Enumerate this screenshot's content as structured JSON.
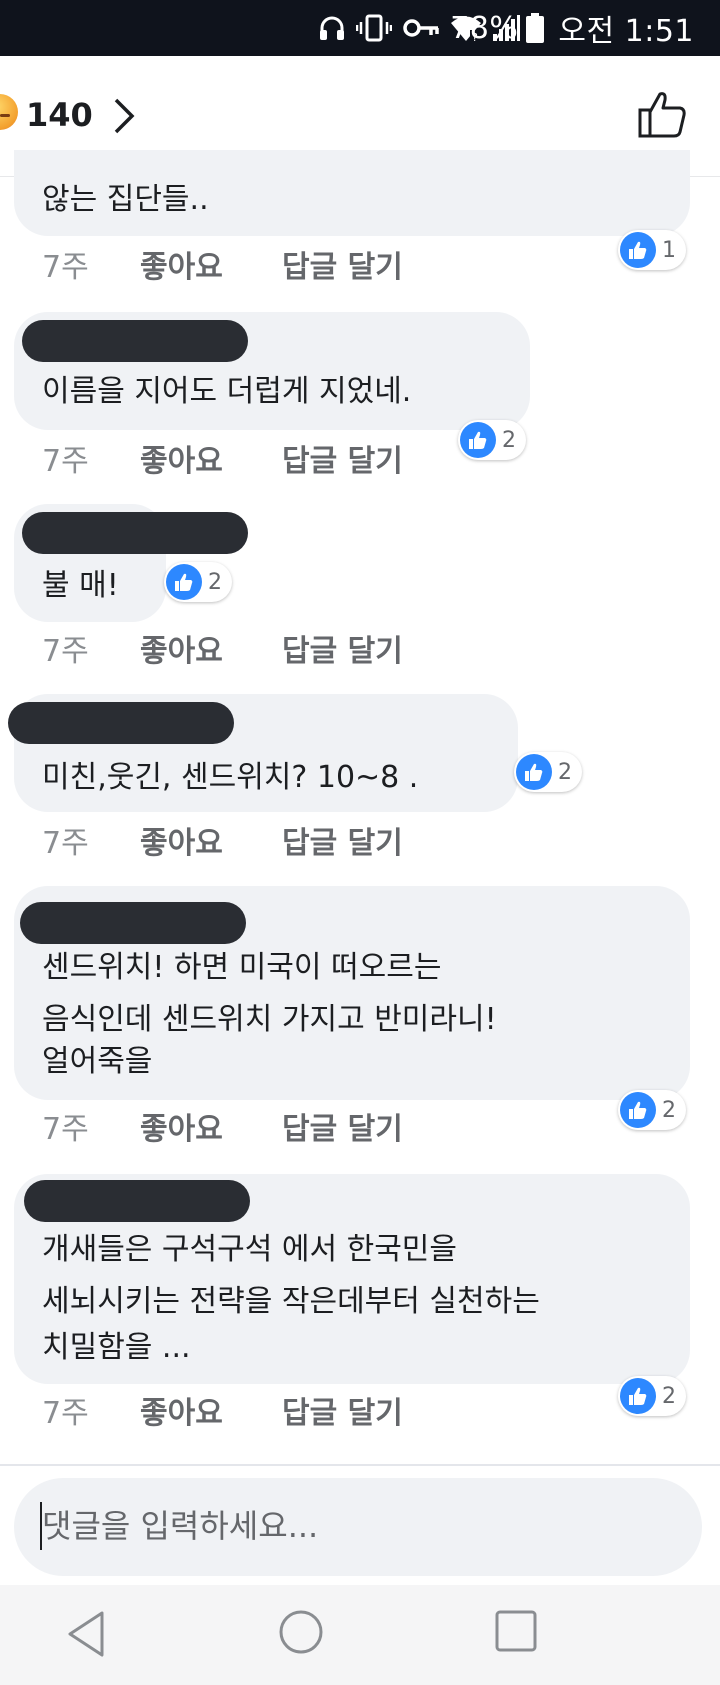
{
  "status_bar": {
    "battery": "78%",
    "time": "오전 1:51"
  },
  "header": {
    "reaction_count": "140"
  },
  "comments": [
    {
      "text_lines": [
        "않는 집단들.."
      ],
      "time": "7주",
      "like_label": "좋아요",
      "reply_label": "답글 달기",
      "reaction_count": "1"
    },
    {
      "text_lines": [
        "이름을 지어도 더럽게 지었네."
      ],
      "time": "7주",
      "like_label": "좋아요",
      "reply_label": "답글 달기",
      "reaction_count": "2"
    },
    {
      "text_lines": [
        "불 매!"
      ],
      "time": "7주",
      "like_label": "좋아요",
      "reply_label": "답글 달기",
      "reaction_count": "2"
    },
    {
      "text_lines": [
        "미친,웃긴, 센드위치? 10~8 ."
      ],
      "time": "7주",
      "like_label": "좋아요",
      "reply_label": "답글 달기",
      "reaction_count": "2"
    },
    {
      "text_lines": [
        "센드위치! 하면 미국이 떠오르는",
        "음식인데  센드위치 가지고 반미라니!",
        "얼어죽을"
      ],
      "time": "7주",
      "like_label": "좋아요",
      "reply_label": "답글 달기",
      "reaction_count": "2"
    },
    {
      "text_lines": [
        "개새들은 구석구석 에서 한국민을",
        "세뇌시키는 전략을 작은데부터 실천하는",
        "치밀함을 ..."
      ],
      "time": "7주",
      "like_label": "좋아요",
      "reply_label": "답글 달기",
      "reaction_count": "2"
    }
  ],
  "comment_input": {
    "placeholder": "댓글을 입력하세요..."
  },
  "nav_bar": {
    "buttons": [
      "back-icon",
      "home-icon",
      "recents-icon"
    ]
  },
  "colors": {
    "status_bar": "#0f131c",
    "bubble": "#f0f2f5",
    "like_blue": "#2d88ff",
    "meta_gray": "#8a8d91"
  }
}
